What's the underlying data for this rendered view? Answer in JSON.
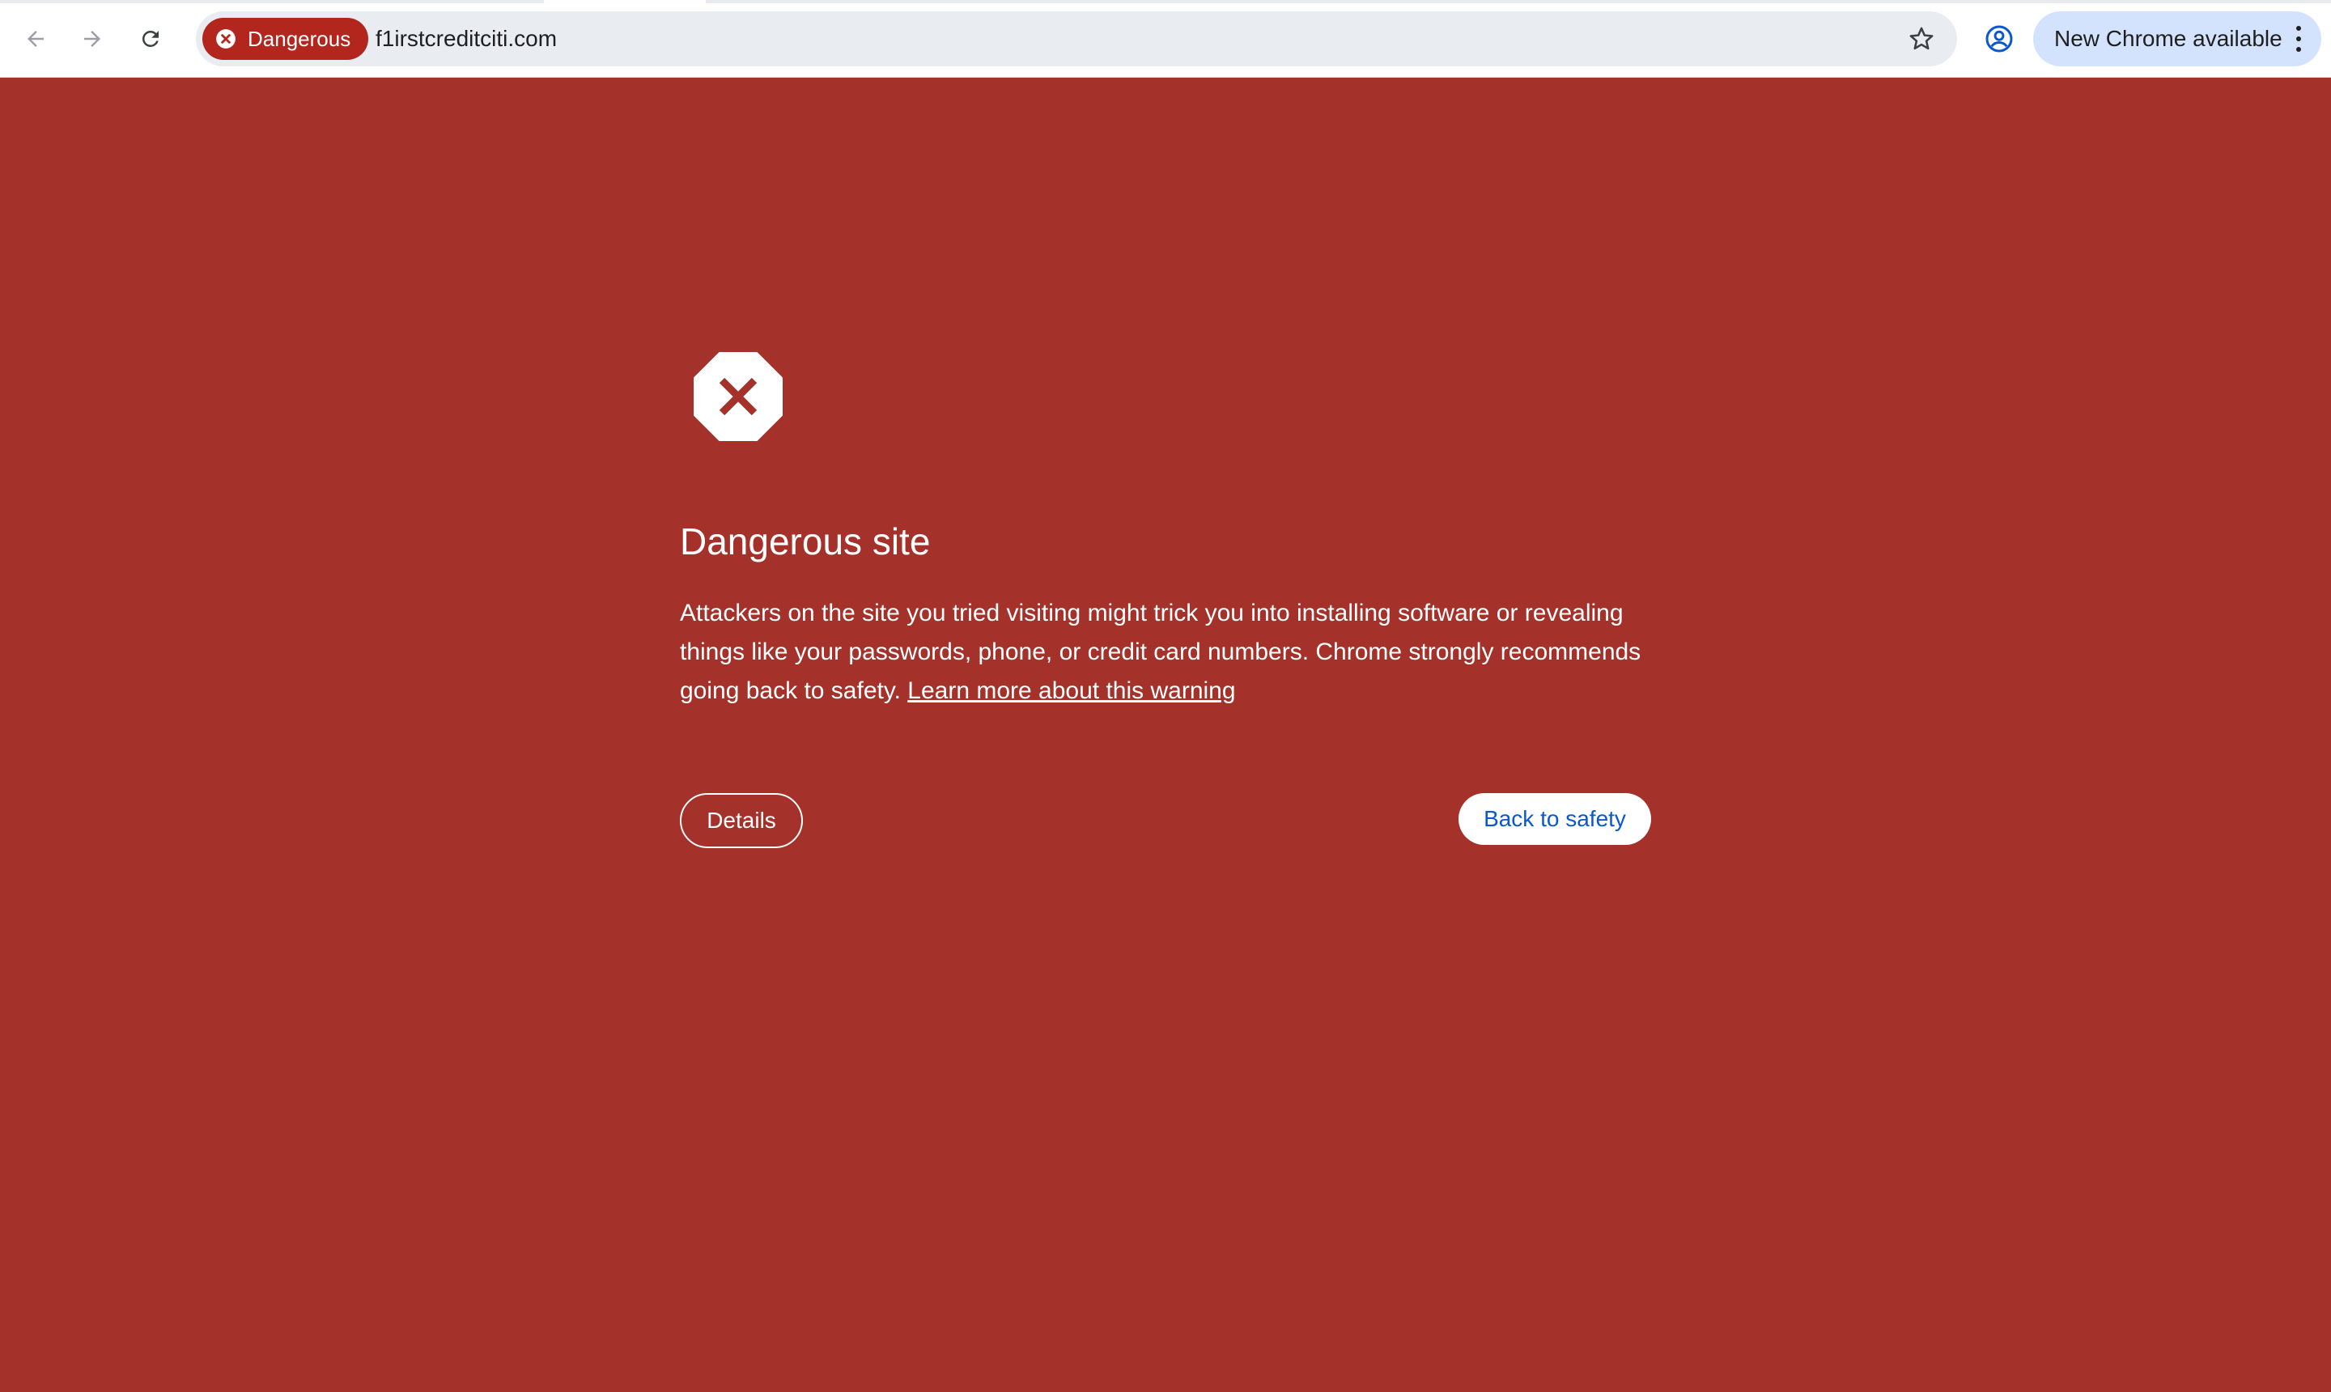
{
  "browser": {
    "security_chip_label": "Dangerous",
    "url": "f1irstcreditciti.com",
    "update_label": "New Chrome available",
    "icons": {
      "back": "arrow-left-icon",
      "forward": "arrow-right-icon",
      "reload": "reload-icon",
      "chip": "x-circle-icon",
      "bookmark": "star-icon",
      "profile": "account-circle-icon",
      "menu": "more-vert-icon"
    }
  },
  "interstitial": {
    "icon": "stop-octagon-x-icon",
    "title": "Dangerous site",
    "body": "Attackers on the site you tried visiting might trick you into installing software or revealing things like your passwords, phone, or credit card numbers. Chrome strongly recommends going back to safety.",
    "learn_more": "Learn more about this warning",
    "details_label": "Details",
    "back_to_safety_label": "Back to safety"
  },
  "colors": {
    "page_background": "#a5322a",
    "chip_background": "#b3261e",
    "update_pill": "#d3e3fd",
    "primary_button_text": "#0b57d0"
  }
}
